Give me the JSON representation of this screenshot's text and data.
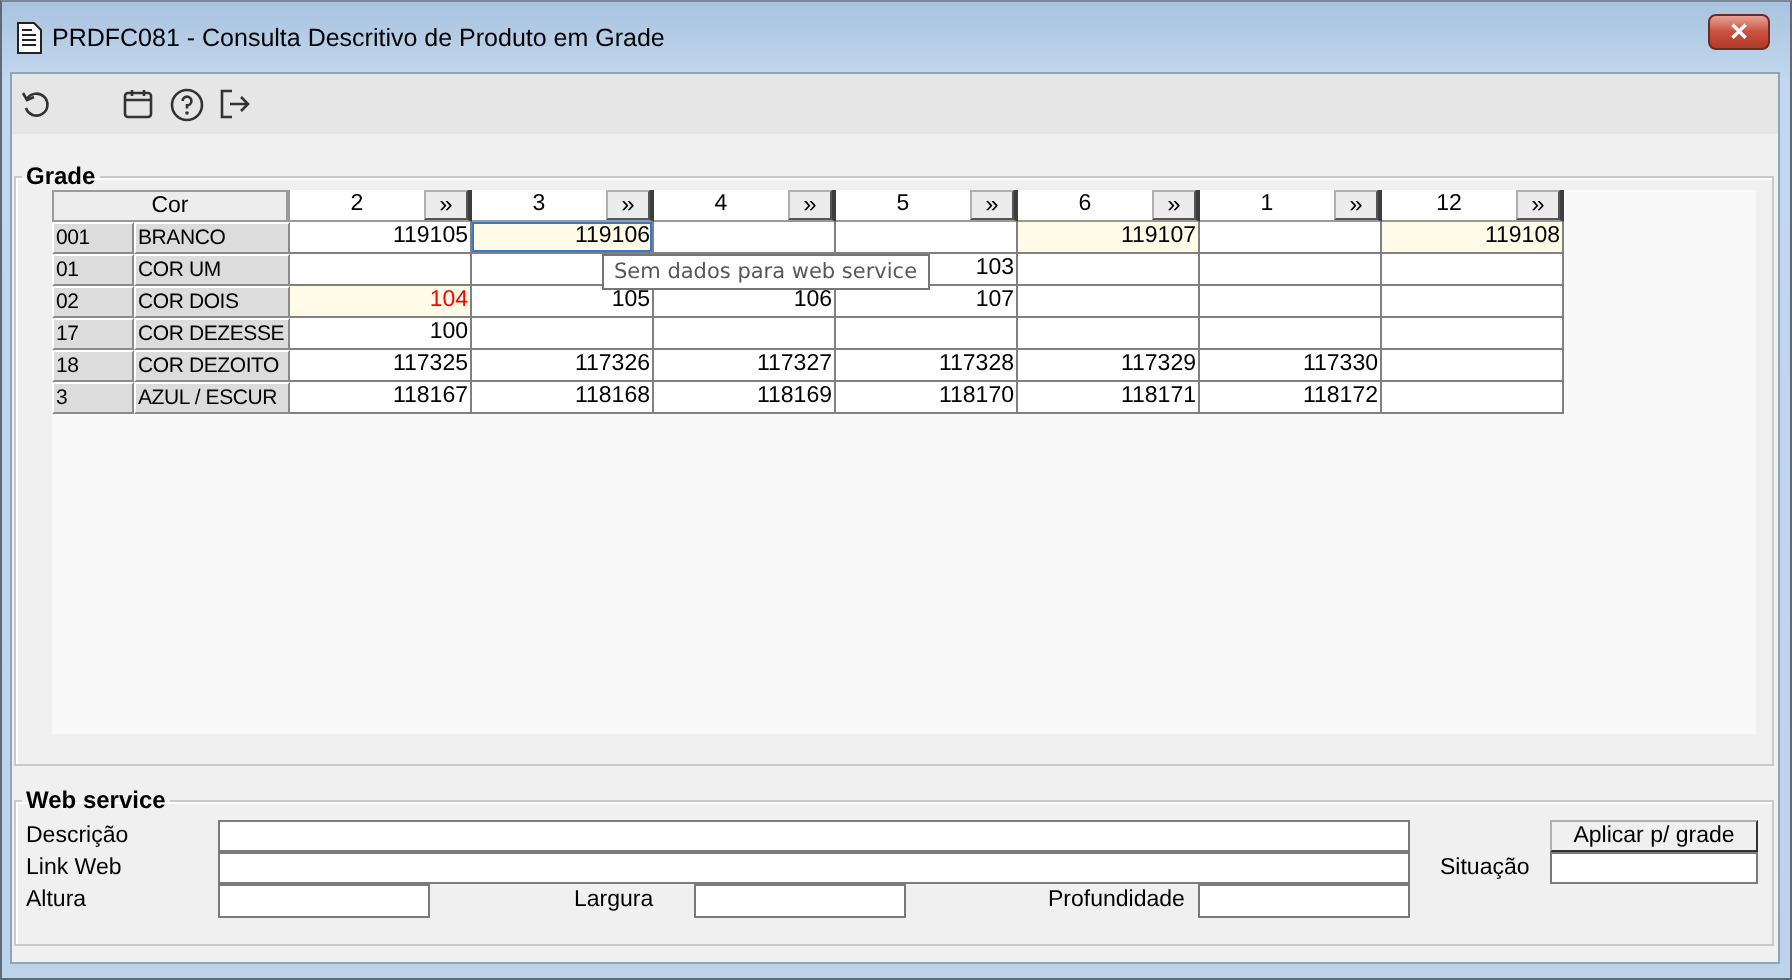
{
  "window": {
    "title": "PRDFC081 - Consulta Descritivo de Produto em Grade",
    "close": "✕"
  },
  "grade": {
    "title": "Grade",
    "corner": "Cor",
    "columns": [
      {
        "label": "2",
        "button": "»"
      },
      {
        "label": "3",
        "button": "»"
      },
      {
        "label": "4",
        "button": "»"
      },
      {
        "label": "5",
        "button": "»"
      },
      {
        "label": "6",
        "button": "»"
      },
      {
        "label": "1",
        "button": "»"
      },
      {
        "label": "12",
        "button": "»"
      }
    ],
    "rows": [
      {
        "code": "001",
        "name": "BRANCO",
        "cells": [
          {
            "text": "119105",
            "highlighted": false,
            "selected": false,
            "alert": false
          },
          {
            "text": "119106",
            "highlighted": true,
            "selected": true,
            "alert": false
          },
          {
            "highlighted": false,
            "selected": false
          },
          {
            "highlighted": false,
            "selected": false
          },
          {
            "text": "119107",
            "highlighted": true,
            "selected": false,
            "alert": false
          },
          {
            "highlighted": false,
            "selected": false
          },
          {
            "text": "119108",
            "highlighted": true,
            "selected": false,
            "alert": false
          }
        ]
      },
      {
        "code": "01",
        "name": "COR UM",
        "cells": [
          {
            "highlighted": false,
            "selected": false
          },
          {
            "highlighted": false,
            "selected": false
          },
          {},
          {
            "text": "103",
            "highlighted": false,
            "selected": false,
            "alert": false
          },
          {
            "highlighted": false,
            "selected": false
          },
          {
            "highlighted": false,
            "selected": false
          },
          {
            "highlighted": false,
            "selected": false
          }
        ]
      },
      {
        "code": "02",
        "name": "COR DOIS",
        "cells": [
          {
            "text": "104",
            "highlighted": true,
            "selected": false,
            "alert": true
          },
          {
            "text": "105",
            "highlighted": false,
            "selected": false,
            "alert": false
          },
          {
            "text": "106",
            "highlighted": false,
            "selected": false,
            "alert": false
          },
          {
            "text": "107",
            "highlighted": false,
            "selected": false,
            "alert": false
          },
          {
            "highlighted": false,
            "selected": false
          },
          {
            "highlighted": false,
            "selected": false
          },
          {
            "highlighted": false,
            "selected": false
          }
        ]
      },
      {
        "code": "17",
        "name": "COR DEZESSE",
        "cells": [
          {
            "text": "100",
            "highlighted": false,
            "selected": false,
            "alert": false
          },
          {
            "highlighted": false,
            "selected": false
          },
          {
            "highlighted": false,
            "selected": false
          },
          {
            "highlighted": false,
            "selected": false
          },
          {
            "highlighted": false,
            "selected": false
          },
          {
            "highlighted": false,
            "selected": false
          },
          {
            "highlighted": false,
            "selected": false
          }
        ]
      },
      {
        "code": "18",
        "name": "COR DEZOITO",
        "cells": [
          {
            "text": "117325",
            "highlighted": false,
            "selected": false,
            "alert": false
          },
          {
            "text": "117326",
            "highlighted": false,
            "selected": false,
            "alert": false
          },
          {
            "text": "117327",
            "highlighted": false,
            "selected": false,
            "alert": false
          },
          {
            "text": "117328",
            "highlighted": false,
            "selected": false,
            "alert": false
          },
          {
            "text": "117329",
            "highlighted": false,
            "selected": false,
            "alert": false
          },
          {
            "text": "117330",
            "highlighted": false,
            "selected": false,
            "alert": false
          },
          {
            "highlighted": false,
            "selected": false
          }
        ]
      },
      {
        "code": "3",
        "name": "AZUL / ESCUR",
        "cells": [
          {
            "text": "118167",
            "highlighted": false,
            "selected": false,
            "alert": false
          },
          {
            "text": "118168",
            "highlighted": false,
            "selected": false,
            "alert": false
          },
          {
            "text": "118169",
            "highlighted": false,
            "selected": false,
            "alert": false
          },
          {
            "text": "118170",
            "highlighted": false,
            "selected": false,
            "alert": false
          },
          {
            "text": "118171",
            "highlighted": false,
            "selected": false,
            "alert": false
          },
          {
            "text": "118172",
            "highlighted": false,
            "selected": false,
            "alert": false
          },
          {
            "highlighted": false,
            "selected": false
          }
        ]
      }
    ],
    "tooltip": "Sem dados para web service"
  },
  "web_service": {
    "title": "Web service",
    "fields": [
      {
        "label": "Descrição"
      },
      {
        "label": "Link Web"
      },
      {
        "label": "Altura"
      },
      {
        "label": "Largura"
      },
      {
        "label": "Profundidade"
      },
      {
        "label": "Situação"
      }
    ],
    "button": "Aplicar p/ grade"
  }
}
